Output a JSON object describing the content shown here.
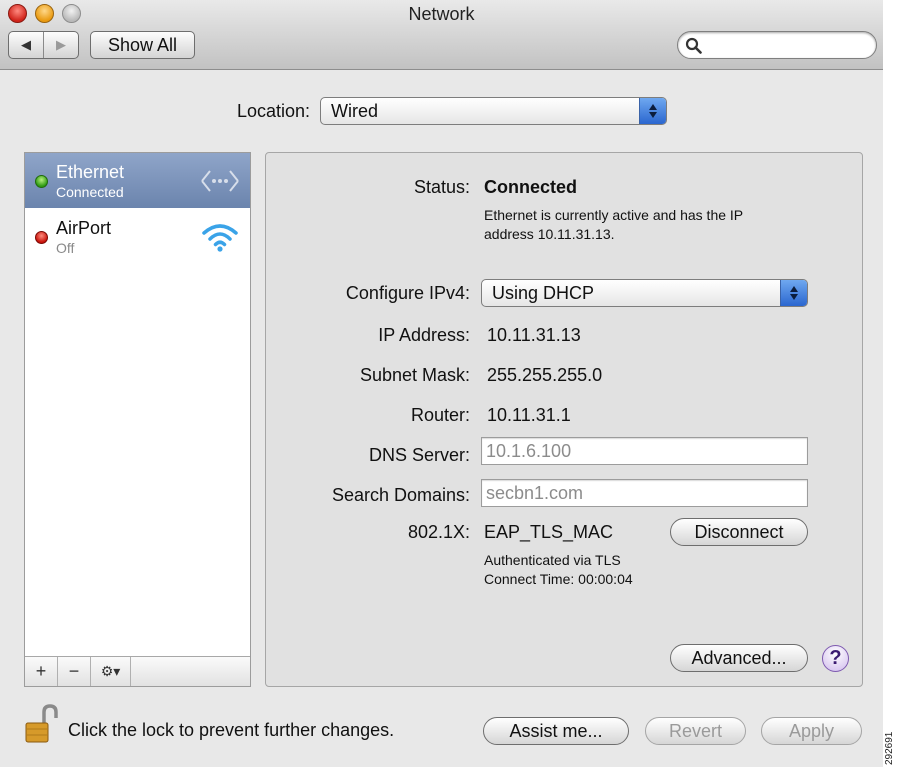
{
  "window": {
    "title": "Network"
  },
  "toolbar": {
    "back_label": "◀",
    "forward_label": "▶",
    "show_all_label": "Show All",
    "search_placeholder": ""
  },
  "location": {
    "label": "Location:",
    "value": "Wired"
  },
  "services": [
    {
      "name": "Ethernet",
      "status": "Connected",
      "indicator": "green",
      "icon": "ethernet-icon"
    },
    {
      "name": "AirPort",
      "status": "Off",
      "indicator": "red",
      "icon": "wifi-icon"
    }
  ],
  "sidebar_actions": {
    "add": "+",
    "remove": "−",
    "gear": "⚙▾"
  },
  "detail": {
    "status_label": "Status:",
    "status_value": "Connected",
    "status_desc_line1": "Ethernet is currently active and has the IP",
    "status_desc_line2": "address 10.11.31.13.",
    "configure_label": "Configure IPv4:",
    "configure_value": "Using DHCP",
    "ip_label": "IP Address:",
    "ip_value": "10.11.31.13",
    "subnet_label": "Subnet Mask:",
    "subnet_value": "255.255.255.0",
    "router_label": "Router:",
    "router_value": "10.11.31.1",
    "dns_label": "DNS Server:",
    "dns_value": "10.1.6.100",
    "search_domains_label": "Search Domains:",
    "search_domains_value": "secbn1.com",
    "dot1x_label": "802.1X:",
    "dot1x_value": "EAP_TLS_MAC",
    "disconnect_label": "Disconnect",
    "auth_line1": "Authenticated via TLS",
    "auth_line2": "Connect Time: 00:00:04",
    "advanced_label": "Advanced...",
    "help_label": "?"
  },
  "footer": {
    "lock_text": "Click the lock to prevent further changes.",
    "assist_label": "Assist me...",
    "revert_label": "Revert",
    "apply_label": "Apply"
  },
  "side_id": "292691"
}
